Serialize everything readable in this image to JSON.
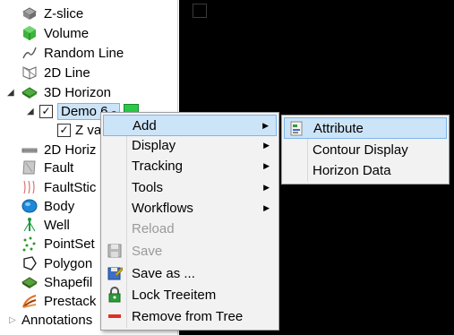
{
  "tree": {
    "items": [
      {
        "label": "Z-slice",
        "icon": "z-slice-icon"
      },
      {
        "label": "Volume",
        "icon": "volume-icon"
      },
      {
        "label": "Random Line",
        "icon": "random-line-icon"
      },
      {
        "label": "2D Line",
        "icon": "2d-line-icon"
      },
      {
        "label": "3D Horizon",
        "icon": "3d-horizon-icon"
      },
      {
        "label": "Demo 6 -",
        "icon": "checkbox"
      },
      {
        "label": "Z va",
        "icon": "checkbox"
      },
      {
        "label": "2D Horiz",
        "icon": "2d-horizon-icon"
      },
      {
        "label": "Fault",
        "icon": "fault-icon"
      },
      {
        "label": "FaultStic",
        "icon": "faultstick-icon"
      },
      {
        "label": "Body",
        "icon": "body-icon"
      },
      {
        "label": "Well",
        "icon": "well-icon"
      },
      {
        "label": "PointSet",
        "icon": "pointset-icon"
      },
      {
        "label": "Polygon",
        "icon": "polygon-icon"
      },
      {
        "label": "Shapefil",
        "icon": "shapefile-icon"
      },
      {
        "label": "Prestack",
        "icon": "prestack-icon"
      },
      {
        "label": "Annotations",
        "icon": "expand-arrow-icon"
      }
    ],
    "swatch_color": "#2bc94a"
  },
  "context_menu": {
    "items": [
      {
        "label": "Add",
        "submenu": true
      },
      {
        "label": "Display",
        "submenu": true
      },
      {
        "label": "Tracking",
        "submenu": true
      },
      {
        "label": "Tools",
        "submenu": true
      },
      {
        "label": "Workflows",
        "submenu": true
      },
      {
        "label": "Reload",
        "disabled": true
      },
      {
        "label": "Save",
        "disabled": true
      },
      {
        "label": "Save as ..."
      },
      {
        "label": "Lock Treeitem"
      },
      {
        "label": "Remove from Tree"
      }
    ]
  },
  "submenu": {
    "items": [
      {
        "label": "Attribute"
      },
      {
        "label": "Contour Display"
      },
      {
        "label": "Horizon Data"
      }
    ]
  }
}
